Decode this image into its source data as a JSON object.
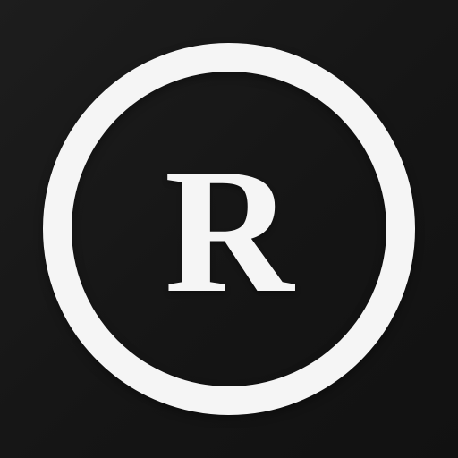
{
  "icon": {
    "name": "registered-trademark",
    "letter": "R",
    "colors": {
      "background": "#161616",
      "foreground": "#f5f5f5"
    }
  }
}
